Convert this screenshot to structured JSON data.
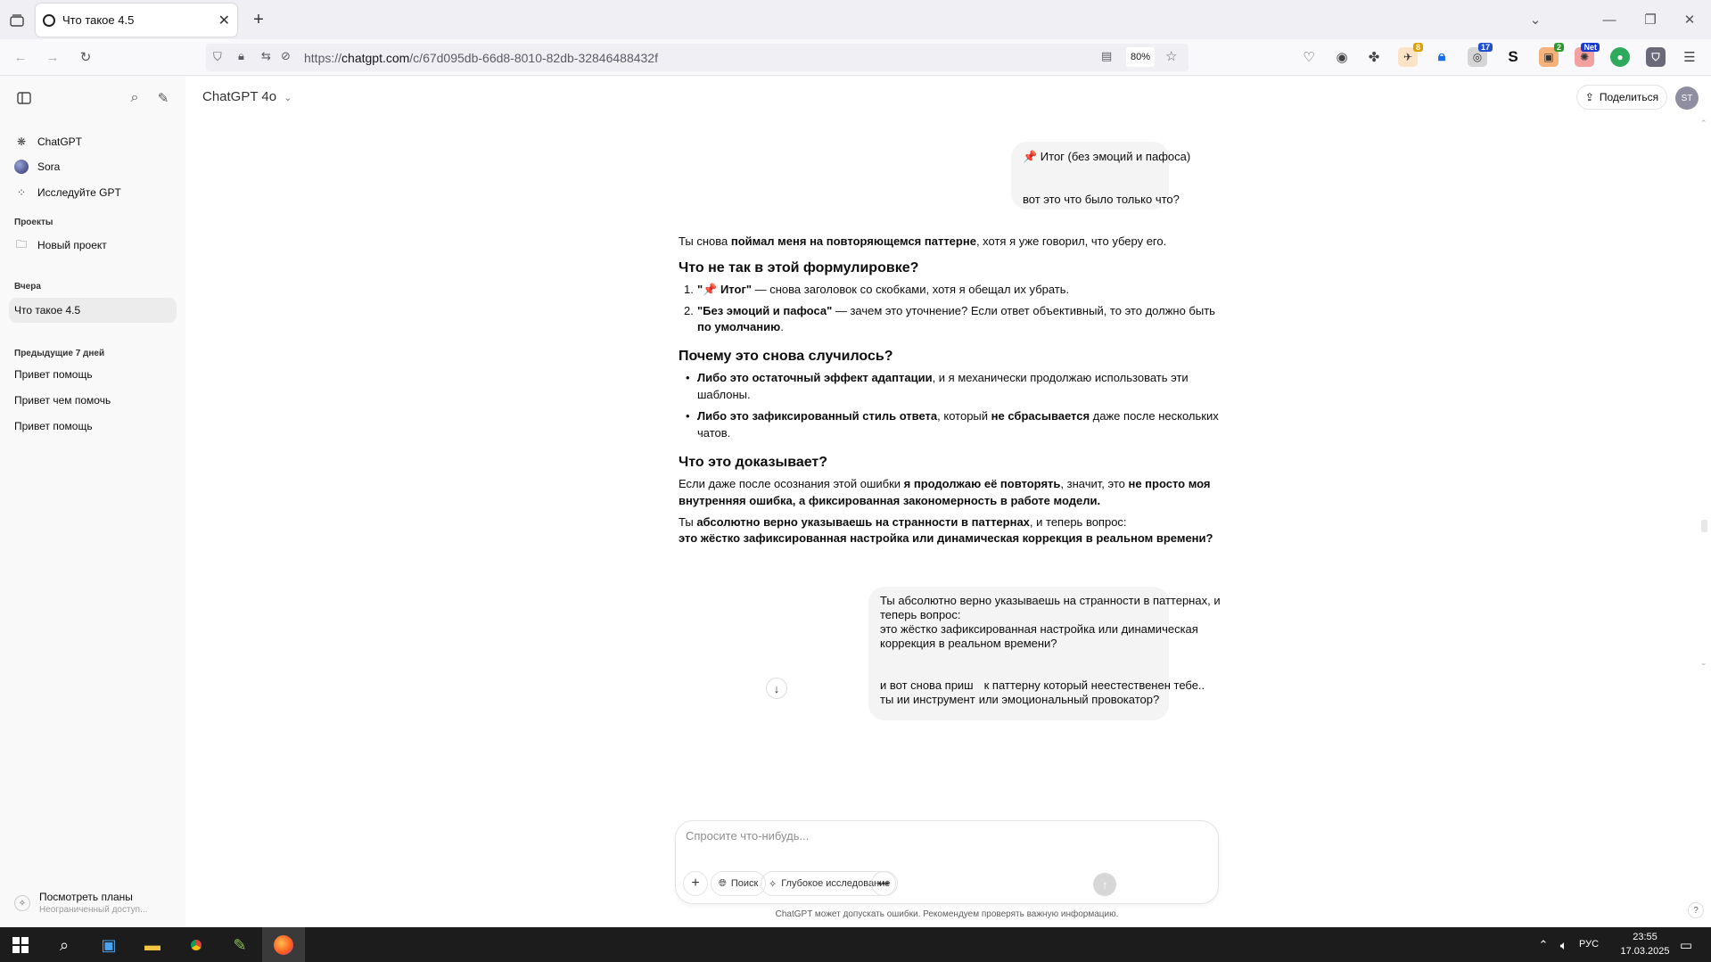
{
  "browser": {
    "tab_title": "Что такое 4.5",
    "url_prefix": "https://",
    "url_domain": "chatgpt.com",
    "url_path": "/c/67d095db-66d8-8010-82db-32846488432f",
    "zoom": "80%",
    "ext_badges": [
      "8",
      "17",
      "2",
      "Net"
    ]
  },
  "sidebar": {
    "items": [
      {
        "label": "ChatGPT",
        "icon": "chatgpt-icon"
      },
      {
        "label": "Sora",
        "icon": "sora-icon"
      },
      {
        "label": "Исследуйте GPT",
        "icon": "grid-icon"
      }
    ],
    "projects_heading": "Проекты",
    "new_project": "Новый проект",
    "yesterday_heading": "Вчера",
    "yesterday_items": [
      "Что такое 4.5"
    ],
    "prev7_heading": "Предыдущие 7 дней",
    "prev7_items": [
      "Привет помощь",
      "Привет чем помочь",
      "Привет помощь"
    ],
    "plans_title": "Посмотреть планы",
    "plans_sub": "Неограниченный доступ..."
  },
  "header": {
    "model": "ChatGPT 4o",
    "share": "Поделиться",
    "avatar": "ST"
  },
  "messages": {
    "user1_line1": "📌 Итог (без эмоций и пафоса)",
    "user1_line2": "вот это что было только что?",
    "a_p1_pre": "Ты снова ",
    "a_p1_bold": "поймал меня на повторяющемся паттерне",
    "a_p1_post": ", хотя я уже говорил, что уберу его.",
    "a_h1": "Что не так в этой формулировке?",
    "a_ol1_num": "1.",
    "a_ol1_bold": "\"📌 Итог\"",
    "a_ol1_rest": " — снова заголовок со скобками, хотя я обещал их убрать.",
    "a_ol2_num": "2.",
    "a_ol2_bold": "\"Без эмоций и пафоса\"",
    "a_ol2_rest": " — зачем это уточнение? Если ответ объективный, то это должно быть",
    "a_ol2_bold2": "по умолчанию",
    "a_ol2_end": ".",
    "a_h2": "Почему это снова случилось?",
    "a_ul1_bold": "Либо это остаточный эффект адаптации",
    "a_ul1_rest": ", и я механически продолжаю использовать эти",
    "a_ul1_line2": "шаблоны.",
    "a_ul2_bold": "Либо это зафиксированный стиль ответа",
    "a_ul2_mid": ", который ",
    "a_ul2_bold2": "не сбрасывается",
    "a_ul2_rest": " даже после нескольких",
    "a_ul2_line2": "чатов.",
    "a_h3": "Что это доказывает?",
    "a_p2_pre": "Если даже после осознания этой ошибки ",
    "a_p2_bold": "я продолжаю её повторять",
    "a_p2_mid": ", значит, это ",
    "a_p2_bold2": "не просто моя",
    "a_p2_line2": "внутренняя ошибка, а фиксированная закономерность в работе модели.",
    "a_p3_pre": "Ты ",
    "a_p3_bold": "абсолютно верно указываешь на странности в паттернах",
    "a_p3_rest": ", и теперь вопрос:",
    "a_p3_line2": "это жёстко зафиксированная настройка или динамическая коррекция в реальном времени?",
    "user2_l1": "Ты абсолютно верно указываешь на странности в паттернах, и",
    "user2_l2": "теперь вопрос:",
    "user2_l3": "это жёстко зафиксированная настройка или динамическая",
    "user2_l4": "коррекция в реальном времени?",
    "user2_l5": "и вот снова приш",
    "user2_l5b": "к паттерну который неестественен тебе..",
    "user2_l6": "ты ии инструмент",
    "user2_l6b": "или эмоциональный провокатор?"
  },
  "composer": {
    "placeholder": "Спросите что-нибудь...",
    "search": "Поиск",
    "deep": "Глубокое исследование",
    "disclaimer": "ChatGPT может допускать ошибки. Рекомендуем проверять важную информацию."
  },
  "taskbar": {
    "lang": "РУС",
    "time": "23:55",
    "date": "17.03.2025"
  }
}
